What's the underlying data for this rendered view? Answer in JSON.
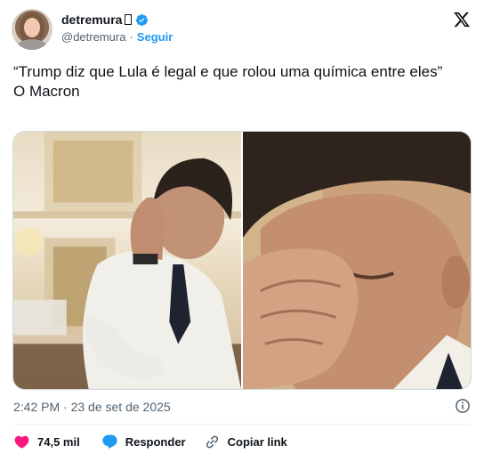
{
  "author": {
    "display_name": "detremura",
    "handle": "@detremura",
    "separator": "·",
    "follow_label": "Seguir"
  },
  "tweet": {
    "line1": "“Trump diz que Lula é legal e que rolou uma química entre eles”",
    "line2": "O Macron"
  },
  "meta": {
    "timestamp": "2:42 PM · 23 de set de 2025"
  },
  "actions": {
    "likes": "74,5 mil",
    "reply_label": "Responder",
    "copy_link_label": "Copiar link"
  },
  "colors": {
    "accent": "#1d9bf0",
    "like": "#f91880",
    "muted": "#536471",
    "text": "#0f1419"
  },
  "icons": {
    "verified": "verified-badge-icon",
    "x_logo": "x-logo-icon",
    "info": "info-icon",
    "like": "heart-icon",
    "reply": "speech-bubble-icon",
    "link": "link-icon"
  }
}
